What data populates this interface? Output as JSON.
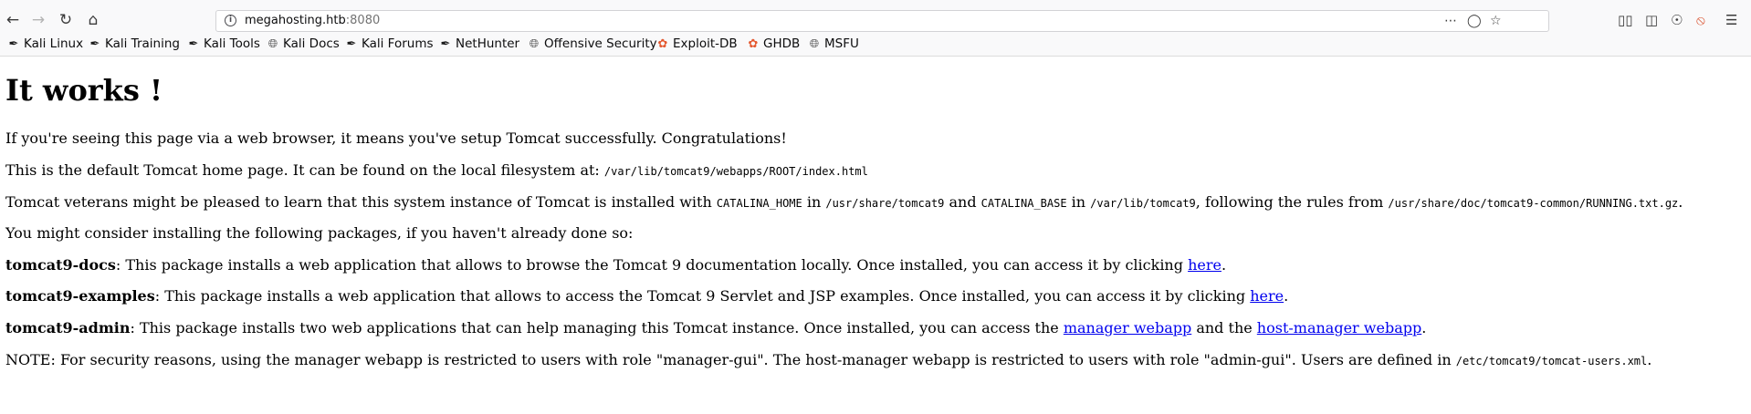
{
  "browser": {
    "url_host": "megahosting.htb",
    "url_port": ":8080"
  },
  "bookmarks": [
    {
      "label": "Kali Linux",
      "icon": "kali-dragon-icon"
    },
    {
      "label": "Kali Training",
      "icon": "kali-dragon-icon"
    },
    {
      "label": "Kali Tools",
      "icon": "kali-dragon-icon"
    },
    {
      "label": "Kali Docs",
      "icon": "globe-icon"
    },
    {
      "label": "Kali Forums",
      "icon": "kali-dragon-icon"
    },
    {
      "label": "NetHunter",
      "icon": "kali-dragon-icon"
    },
    {
      "label": "Offensive Security",
      "icon": "globe-icon"
    },
    {
      "label": "Exploit-DB",
      "icon": "exploitdb-icon"
    },
    {
      "label": "GHDB",
      "icon": "exploitdb-icon"
    },
    {
      "label": "MSFU",
      "icon": "globe-icon"
    }
  ],
  "page": {
    "heading": "It works !",
    "p1": "If you're seeing this page via a web browser, it means you've setup Tomcat successfully. Congratulations!",
    "p2_text": "This is the default Tomcat home page. It can be found on the local filesystem at: ",
    "p2_code": "/var/lib/tomcat9/webapps/ROOT/index.html",
    "p3_a": "Tomcat veterans might be pleased to learn that this system instance of Tomcat is installed with ",
    "p3_code1": "CATALINA_HOME",
    "p3_b": " in ",
    "p3_code2": "/usr/share/tomcat9",
    "p3_c": " and ",
    "p3_code3": "CATALINA_BASE",
    "p3_d": " in ",
    "p3_code4": "/var/lib/tomcat9",
    "p3_e": ", following the rules from ",
    "p3_code5": "/usr/share/doc/tomcat9-common/RUNNING.txt.gz",
    "p3_f": ".",
    "p4": "You might consider installing the following packages, if you haven't already done so:",
    "docs_name": "tomcat9-docs",
    "docs_text": ": This package installs a web application that allows to browse the Tomcat 9 documentation locally. Once installed, you can access it by clicking ",
    "docs_link": "here",
    "examples_name": "tomcat9-examples",
    "examples_text": ": This package installs a web application that allows to access the Tomcat 9 Servlet and JSP examples. Once installed, you can access it by clicking ",
    "examples_link": "here",
    "admin_name": "tomcat9-admin",
    "admin_text": ": This package installs two web applications that can help managing this Tomcat instance. Once installed, you can access the ",
    "admin_link1": "manager webapp",
    "admin_mid": " and the ",
    "admin_link2": "host-manager webapp",
    "period": ".",
    "note_text": "NOTE: For security reasons, using the manager webapp is restricted to users with role \"manager-gui\". The host-manager webapp is restricted to users with role \"admin-gui\". Users are defined in ",
    "note_code": "/etc/tomcat9/tomcat-users.xml"
  }
}
